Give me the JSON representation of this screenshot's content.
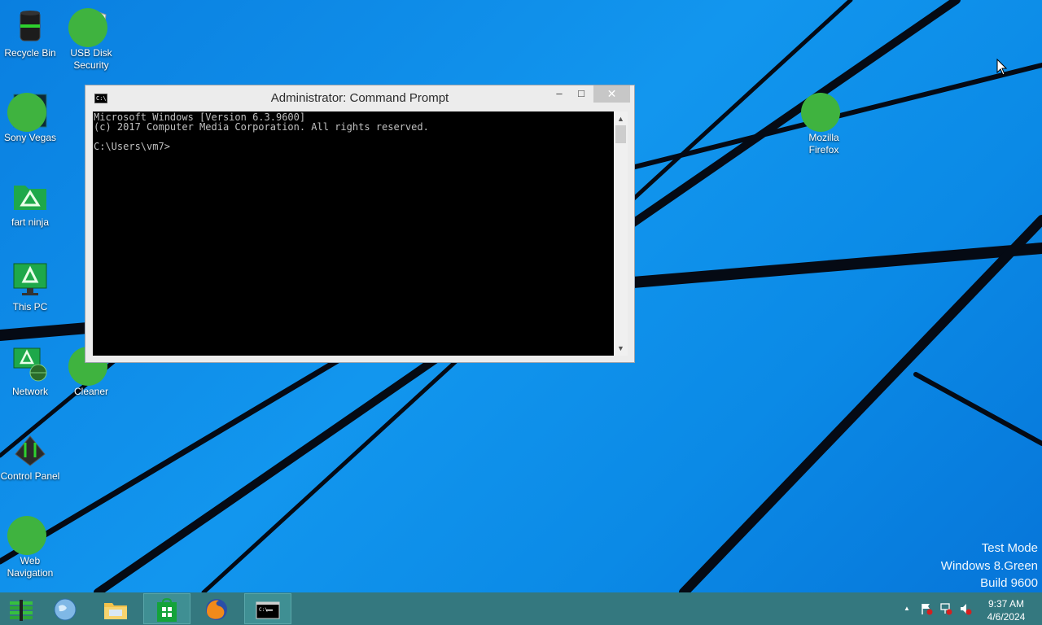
{
  "desktop": {
    "icons": [
      {
        "label": "Recycle Bin",
        "icon": "recycle-bin-icon"
      },
      {
        "label": "USB Disk Security",
        "icon": "shield-icon"
      },
      {
        "label": "Sony Vegas",
        "icon": "sony-vegas-icon"
      },
      {
        "label": "fart ninja",
        "icon": "green-folder-icon"
      },
      {
        "label": "This PC",
        "icon": "monitor-icon"
      },
      {
        "label": "Network",
        "icon": "network-icon"
      },
      {
        "label": "Cleaner",
        "icon": "cleaner-icon"
      },
      {
        "label": "Control Panel",
        "icon": "control-panel-icon"
      },
      {
        "label": "Web Navigation",
        "icon": "globe-icon"
      },
      {
        "label": "Mozilla Firefox",
        "icon": "firefox-icon"
      }
    ]
  },
  "cmd_window": {
    "title": "Administrator: Command Prompt",
    "sys_icon_text": "C:\\",
    "minimize": "–",
    "maximize": "□",
    "close": "✕",
    "console_lines": [
      "Microsoft Windows [Version 6.3.9600]",
      "(c) 2017 Computer Media Corporation. All rights reserved.",
      "",
      "C:\\Users\\vm7>"
    ],
    "scroll_up": "▲",
    "scroll_down": "▼"
  },
  "watermark": {
    "line1": "Test Mode",
    "line2": "Windows 8.Green",
    "line3": "Build 9600"
  },
  "taskbar": {
    "buttons": [
      {
        "name": "start",
        "icon": "windows-start-icon"
      },
      {
        "name": "internet-explorer",
        "icon": "globe-icon"
      },
      {
        "name": "file-explorer",
        "icon": "folder-icon"
      },
      {
        "name": "store",
        "icon": "store-icon"
      },
      {
        "name": "firefox",
        "icon": "firefox-icon"
      },
      {
        "name": "command-prompt",
        "icon": "cmd-icon"
      }
    ],
    "tray": {
      "show_hidden": "▲",
      "time": "9:37 AM",
      "date": "4/6/2024"
    }
  },
  "colors": {
    "desktop_blue": "#1296ee",
    "taskbar": "#34787f",
    "console_bg": "#000000",
    "console_text": "#c0c0c0"
  }
}
